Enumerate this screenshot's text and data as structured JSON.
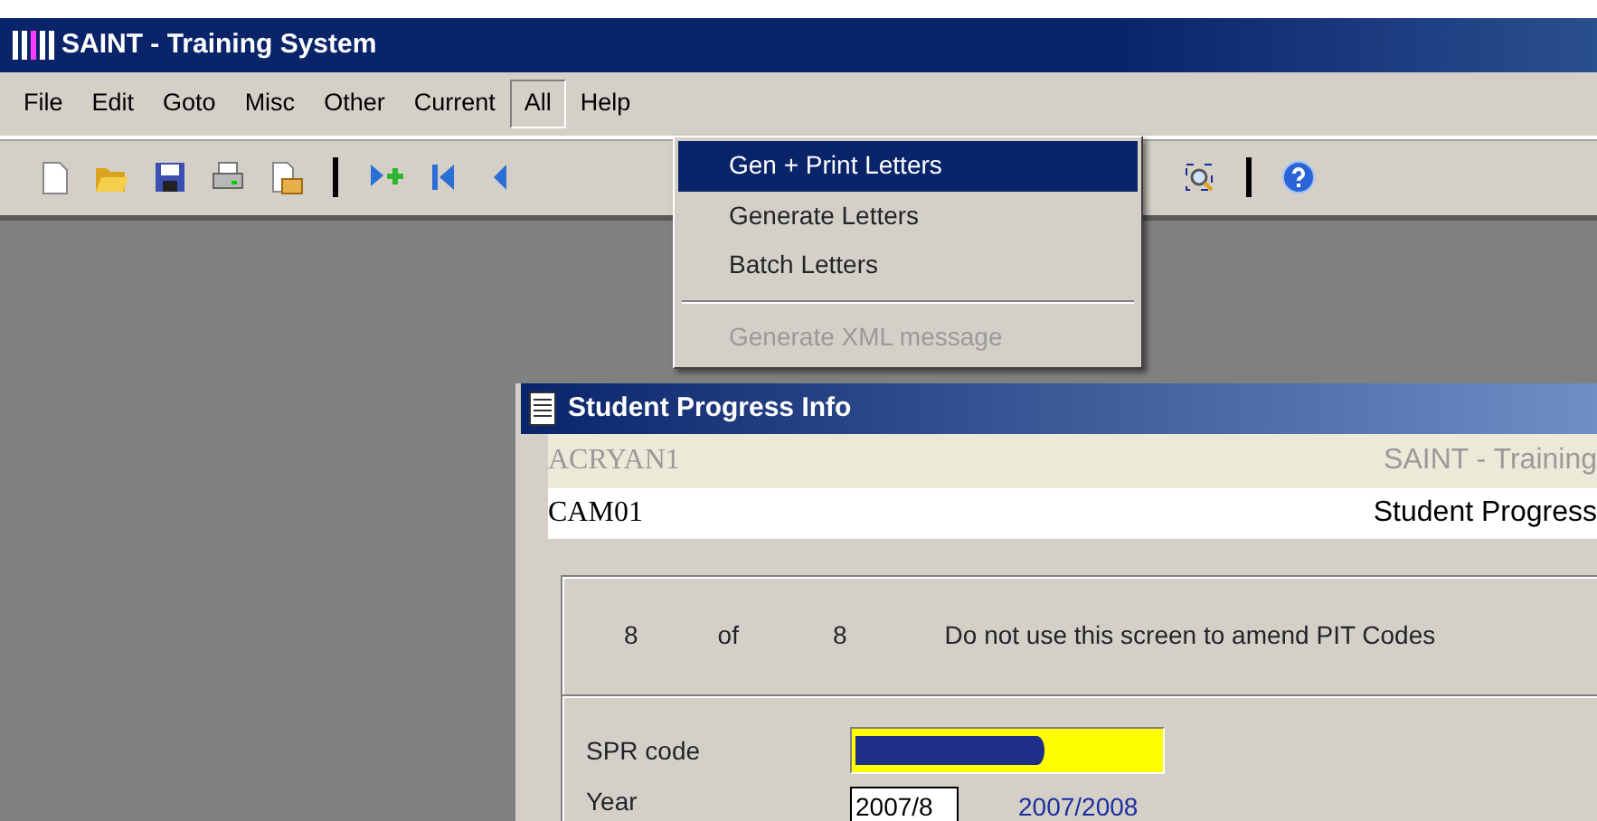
{
  "window": {
    "title": "SAINT - Training System"
  },
  "menu_bar": [
    {
      "label": "File",
      "expanded": false
    },
    {
      "label": "Edit",
      "expanded": false
    },
    {
      "label": "Goto",
      "expanded": false
    },
    {
      "label": "Misc",
      "expanded": false
    },
    {
      "label": "Other",
      "expanded": false
    },
    {
      "label": "Current",
      "expanded": false
    },
    {
      "label": "All",
      "expanded": true
    },
    {
      "label": "Help",
      "expanded": false
    }
  ],
  "dropdown": [
    {
      "kind": "item",
      "label": "Gen + Print Letters",
      "selected": true,
      "disabled": false
    },
    {
      "kind": "item",
      "label": "Generate Letters",
      "selected": false,
      "disabled": false
    },
    {
      "kind": "item",
      "label": "Batch Letters",
      "selected": false,
      "disabled": false
    },
    {
      "kind": "separator"
    },
    {
      "kind": "item",
      "label": "Generate XML message",
      "selected": false,
      "disabled": true
    }
  ],
  "child_window": {
    "title": "Student Progress Info",
    "user": "ACRYAN1",
    "system": "SAINT - Training",
    "code": "CAM01",
    "screen": "Student Progress",
    "record": {
      "current": "8",
      "of": "of",
      "total": "8"
    },
    "notice": "Do not use this screen to amend PIT Codes",
    "fields": [
      {
        "kind": "redacted",
        "label": "SPR code"
      },
      {
        "kind": "text",
        "label": "Year",
        "value": "2007/8",
        "description": "2007/2008"
      }
    ]
  }
}
